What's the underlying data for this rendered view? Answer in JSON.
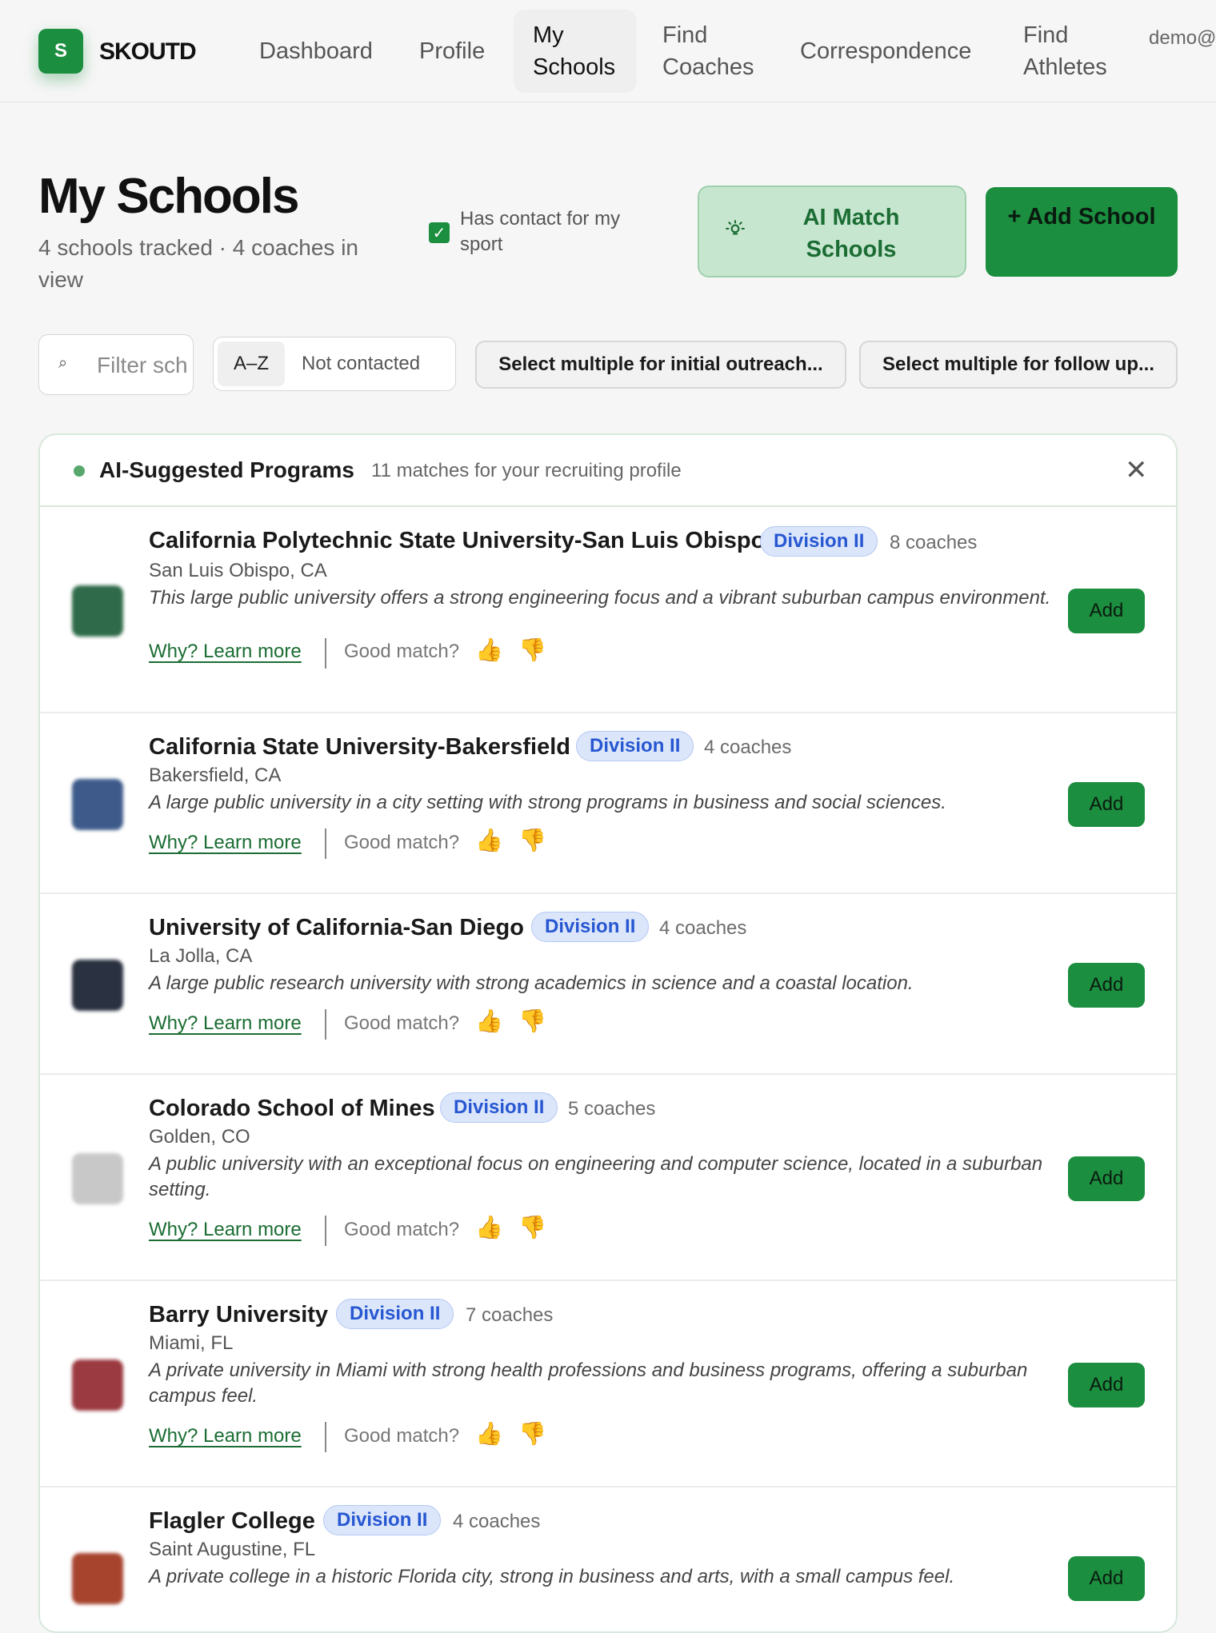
{
  "nav": {
    "logo_letter": "S",
    "brand": "SKOUTD",
    "items": [
      {
        "label": "Dashboard"
      },
      {
        "label": "Profile"
      },
      {
        "label": "My Schools"
      },
      {
        "label": "Find Coaches"
      },
      {
        "label": "Correspondence"
      },
      {
        "label": "Find Athletes"
      }
    ],
    "user": "demo@"
  },
  "header": {
    "title": "My Schools",
    "subtitle": "4 schools tracked · 4 coaches in view",
    "contact_filter_label": "Has contact for my sport",
    "ai_match_label": "AI Match Schools",
    "add_school_label": "+ Add School"
  },
  "toolbar": {
    "filter_placeholder": "Filter schools",
    "sort_options": [
      "A–Z",
      "Not contacted"
    ],
    "multi_outreach_label": "Select multiple for initial outreach...",
    "multi_followup_label": "Select multiple for follow up..."
  },
  "suggestions": {
    "title": "AI-Suggested Programs",
    "subtitle": "11 matches for your recruiting profile",
    "learn_more_label": "Why? Learn more",
    "good_match_label": "Good match?",
    "add_label": "Add",
    "items": [
      {
        "name": "California Polytechnic State University-San Luis Obispo",
        "division": "Division II",
        "coaches": "8 coaches",
        "location": "San Luis Obispo, CA",
        "description": "This large public university offers a strong engineering focus and a vibrant suburban campus environment.",
        "logo_color": "#2f6b4a"
      },
      {
        "name": "California State University-Bakersfield",
        "division": "Division II",
        "coaches": "4 coaches",
        "location": "Bakersfield, CA",
        "description": "A large public university in a city setting with strong programs in business and social sciences.",
        "logo_color": "#3d5a8a"
      },
      {
        "name": "University of California-San Diego",
        "division": "Division II",
        "coaches": "4 coaches",
        "location": "La Jolla, CA",
        "description": "A large public research university with strong academics in science and a coastal location.",
        "logo_color": "#2a3140"
      },
      {
        "name": "Colorado School of Mines",
        "division": "Division II",
        "coaches": "5 coaches",
        "location": "Golden, CO",
        "description": "A public university with an exceptional focus on engineering and computer science, located in a suburban setting.",
        "logo_color": "#c8c8c8"
      },
      {
        "name": "Barry University",
        "division": "Division II",
        "coaches": "7 coaches",
        "location": "Miami, FL",
        "description": "A private university in Miami with strong health professions and business programs, offering a suburban campus feel.",
        "logo_color": "#9b3a40"
      },
      {
        "name": "Flagler College",
        "division": "Division II",
        "coaches": "4 coaches",
        "location": "Saint Augustine, FL",
        "description": "A private college in a historic Florida city, strong in business and arts, with a small campus feel.",
        "logo_color": "#a7442e"
      }
    ]
  }
}
